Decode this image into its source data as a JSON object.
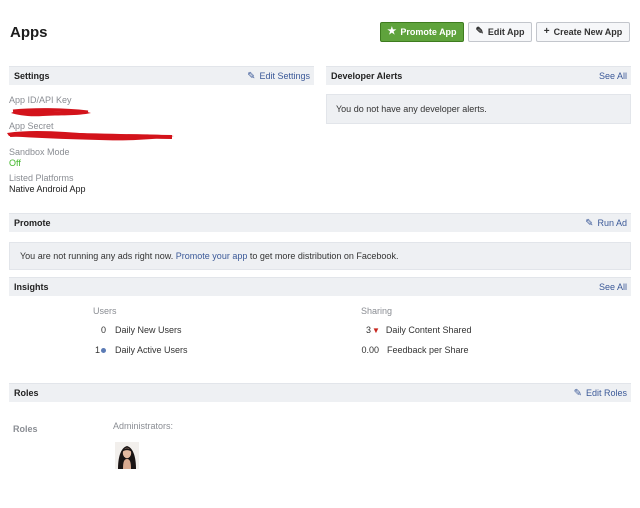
{
  "page": {
    "title": "Apps"
  },
  "top_buttons": {
    "promote": "Promote App",
    "edit": "Edit App",
    "create": "Create New App",
    "promote_icon": "star-icon",
    "edit_icon": "pencil-icon",
    "create_icon": "plus-icon"
  },
  "settings": {
    "title": "Settings",
    "edit_link": "Edit Settings",
    "fields": [
      {
        "label": "App ID/API Key",
        "value": ""
      },
      {
        "label": "App Secret",
        "value": ""
      },
      {
        "label": "Sandbox Mode",
        "value": "Off"
      },
      {
        "label": "Listed Platforms",
        "value": "Native Android App"
      }
    ]
  },
  "alerts": {
    "title": "Developer Alerts",
    "see_all": "See All",
    "message": "You do not have any developer alerts."
  },
  "promote": {
    "title": "Promote",
    "run_ad": "Run Ad",
    "message_pre": "You are not running any ads right now.",
    "message_link": "Promote your app",
    "message_post": "to get more distribution on Facebook."
  },
  "insights": {
    "title": "Insights",
    "see_all": "See All",
    "users_header": "Users",
    "sharing_header": "Sharing",
    "users": [
      {
        "value": "0",
        "label": "Daily New Users"
      },
      {
        "value": "1",
        "label": "Daily Active Users"
      }
    ],
    "sharing": [
      {
        "value": "3",
        "label": "Daily Content Shared"
      },
      {
        "value": "0.00",
        "label": "Feedback per Share"
      }
    ]
  },
  "roles": {
    "title": "Roles",
    "edit_link": "Edit Roles",
    "row_label": "Roles",
    "admins_label": "Administrators:"
  },
  "colors": {
    "promote_green": "#5fa33c",
    "link_blue": "#3b5998",
    "redaction_red": "#d3131b",
    "off_green": "#42b72a"
  }
}
